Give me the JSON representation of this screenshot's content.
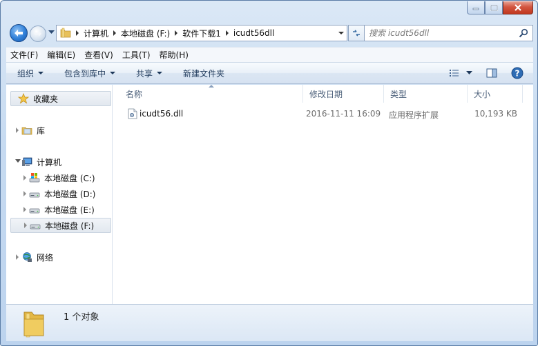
{
  "window": {
    "caption_buttons": [
      "minimize",
      "maximize",
      "close"
    ]
  },
  "address": {
    "crumbs": [
      "计算机",
      "本地磁盘 (F:)",
      "软件下载1",
      "icudt56dll"
    ]
  },
  "search": {
    "placeholder": "搜索 icudt56dll"
  },
  "menu": {
    "items": [
      "文件(F)",
      "编辑(E)",
      "查看(V)",
      "工具(T)",
      "帮助(H)"
    ]
  },
  "toolbar": {
    "organize": "组织",
    "include_in_library": "包含到库中",
    "share": "共享",
    "new_folder": "新建文件夹"
  },
  "sidebar": {
    "favorites": "收藏夹",
    "libraries": "库",
    "computer": "计算机",
    "drives": [
      "本地磁盘 (C:)",
      "本地磁盘 (D:)",
      "本地磁盘 (E:)",
      "本地磁盘 (F:)"
    ],
    "network": "网络"
  },
  "columns": {
    "name": "名称",
    "modified": "修改日期",
    "type": "类型",
    "size": "大小"
  },
  "files": [
    {
      "name": "icudt56.dll",
      "modified": "2016-11-11 16:09",
      "type": "应用程序扩展",
      "size": "10,193 KB"
    }
  ],
  "details": {
    "count": "1 个对象"
  },
  "colors": {
    "frame": "#c7dbf1",
    "command_text": "#1e395b",
    "header_text": "#4c607a",
    "close_button": "#c1381f"
  }
}
